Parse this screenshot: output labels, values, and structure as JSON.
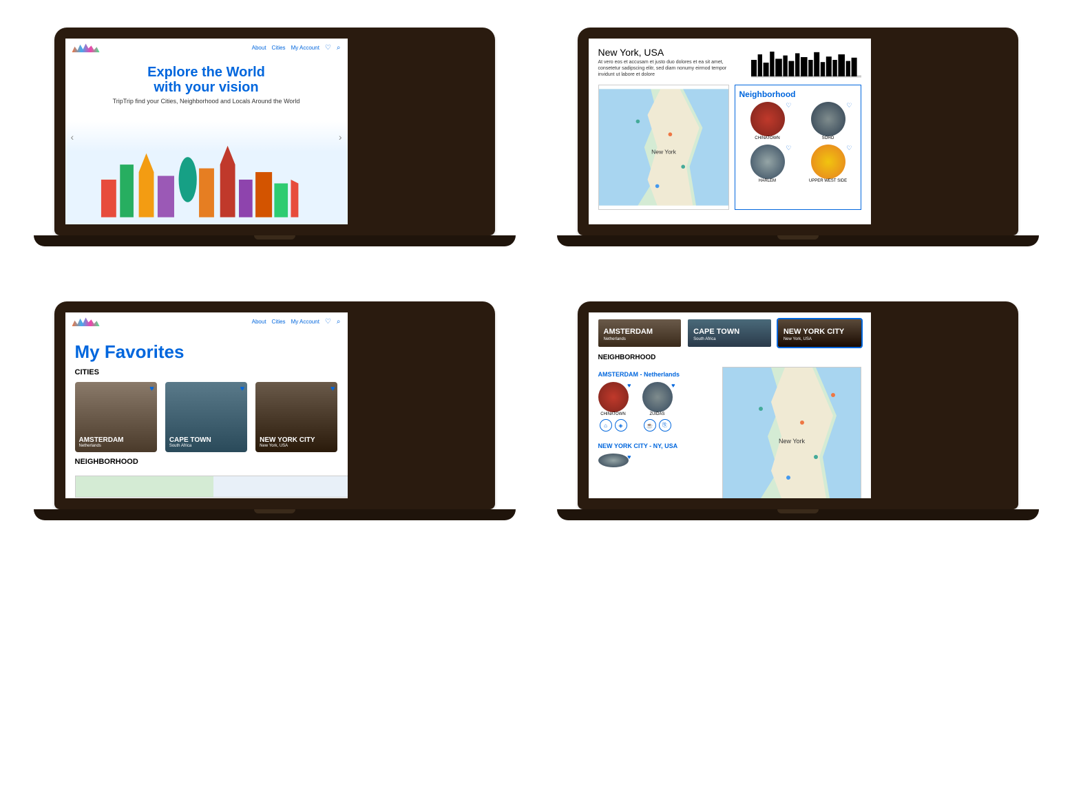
{
  "nav": {
    "about": "About",
    "cities": "Cities",
    "account": "My Account"
  },
  "screen1": {
    "heroLine1": "Explore the World",
    "heroLine2": "with your vision",
    "subtitle": "TripTrip find your Cities, Neighborhood and Locals Around the World"
  },
  "screen2": {
    "city": "New York, USA",
    "desc": "At vero eos et accusam et justo duo dolores et ea sit amet, consetetur sadipscing elitr, sed diam nonumy eirmod tempor invidunt ut labore et dolore",
    "panelTitle": "Neighborhood",
    "neighborhoods": [
      {
        "name": "CHINATOWN"
      },
      {
        "name": "SOHO"
      },
      {
        "name": "HARLEM"
      },
      {
        "name": "UPPER WEST SIDE"
      }
    ]
  },
  "screen3": {
    "title": "My Favorites",
    "citiesHeader": "CITIES",
    "cityCards": [
      {
        "name": "AMSTERDAM",
        "country": "Netherlands"
      },
      {
        "name": "CAPE TOWN",
        "country": "South Africa"
      },
      {
        "name": "NEW YORK CITY",
        "country": "New York, USA"
      }
    ],
    "neighborhoodHeader": "NEIGHBORHOOD"
  },
  "screen4": {
    "cityBar": [
      {
        "name": "AMSTERDAM",
        "country": "Netherlands"
      },
      {
        "name": "CAPE TOWN",
        "country": "South Africa"
      },
      {
        "name": "NEW YORK CITY",
        "country": "New York, USA"
      }
    ],
    "neighborhoodHeader": "NEIGHBORHOOD",
    "group1Title": "AMSTERDAM - Netherlands",
    "group1Items": [
      {
        "name": "CHINATOWN"
      },
      {
        "name": "ZUIDAS"
      }
    ],
    "group2Title": "NEW YORK CITY - NY, USA"
  }
}
